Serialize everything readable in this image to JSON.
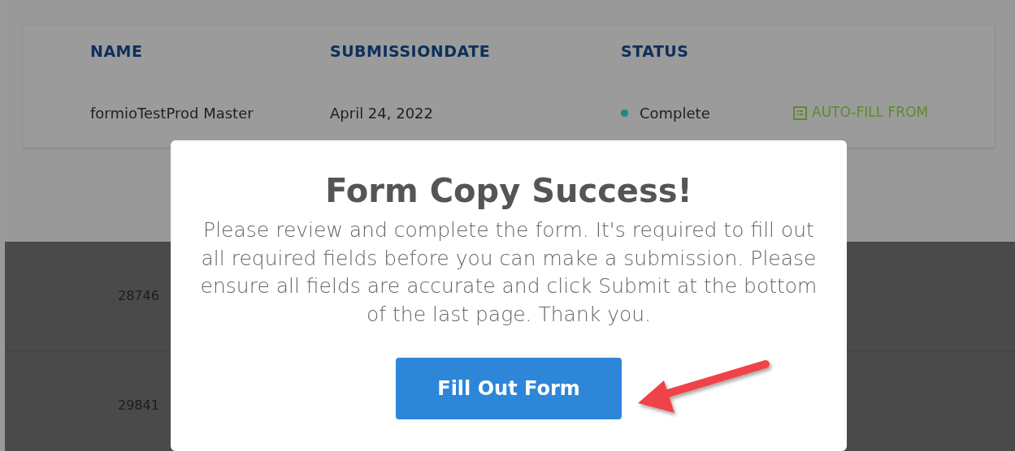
{
  "table": {
    "columns": [
      "NAME",
      "SUBMISSIONDATE",
      "STATUS"
    ],
    "rows": [
      {
        "name": "formioTestProd Master",
        "submission_date": "April 24, 2022",
        "status": "Complete",
        "color": "#1a8a8a",
        "action": "AUTO-FILL FROM"
      }
    ]
  },
  "background_rows": [
    {
      "column_1": "28746"
    },
    {
      "column_1": "29841"
    }
  ],
  "modal": {
    "title": "Form Copy Success!",
    "message": "Please review and complete the form. It's required to fill out all required fields before you can make a submission. Please ensure all fields are accurate and click Submit at the bottom of the last page. Thank you.",
    "button": "Fill Out Form"
  }
}
